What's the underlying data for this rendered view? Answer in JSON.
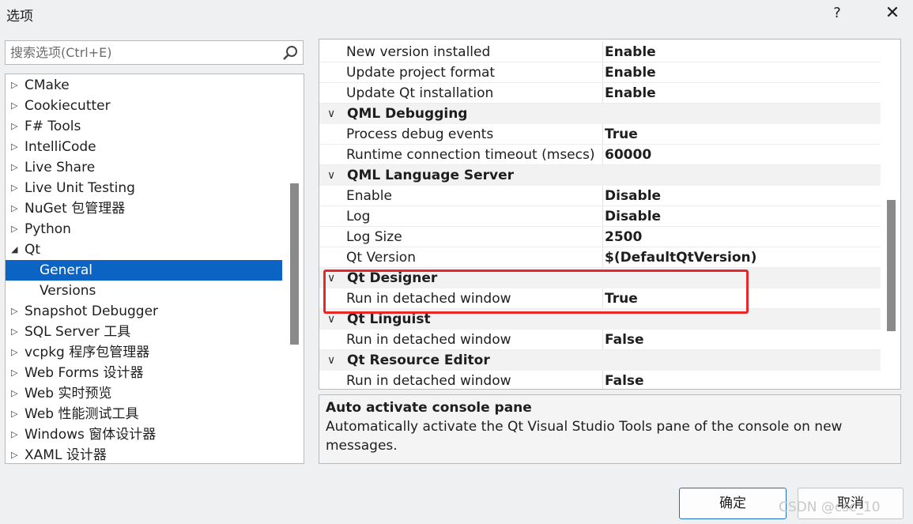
{
  "window": {
    "title": "选项",
    "help_glyph": "?",
    "close_glyph": "✕"
  },
  "search": {
    "placeholder": "搜索选项(Ctrl+E)",
    "icon": "search-icon"
  },
  "tree": {
    "collapsed_glyph": "▷",
    "expanded_glyph": "◢",
    "items": [
      {
        "label": "CMake",
        "state": "collapsed"
      },
      {
        "label": "Cookiecutter",
        "state": "collapsed"
      },
      {
        "label": "F# Tools",
        "state": "collapsed"
      },
      {
        "label": "IntelliCode",
        "state": "collapsed"
      },
      {
        "label": "Live Share",
        "state": "collapsed"
      },
      {
        "label": "Live Unit Testing",
        "state": "collapsed"
      },
      {
        "label": "NuGet 包管理器",
        "state": "collapsed"
      },
      {
        "label": "Python",
        "state": "collapsed"
      },
      {
        "label": "Qt",
        "state": "expanded"
      },
      {
        "label": "General",
        "state": "child",
        "selected": true
      },
      {
        "label": "Versions",
        "state": "child"
      },
      {
        "label": "Snapshot Debugger",
        "state": "collapsed"
      },
      {
        "label": "SQL Server 工具",
        "state": "collapsed"
      },
      {
        "label": "vcpkg 程序包管理器",
        "state": "collapsed"
      },
      {
        "label": "Web Forms 设计器",
        "state": "collapsed"
      },
      {
        "label": "Web 实时预览",
        "state": "collapsed"
      },
      {
        "label": "Web 性能测试工具",
        "state": "collapsed"
      },
      {
        "label": "Windows 窗体设计器",
        "state": "collapsed"
      },
      {
        "label": "XAML 设计器",
        "state": "collapsed"
      }
    ]
  },
  "grid": {
    "chevron_glyph": "∨",
    "rows": [
      {
        "type": "prop",
        "name": "New version installed",
        "value": "Enable"
      },
      {
        "type": "prop",
        "name": "Update project format",
        "value": "Enable"
      },
      {
        "type": "prop",
        "name": "Update Qt installation",
        "value": "Enable"
      },
      {
        "type": "cat",
        "name": "QML Debugging"
      },
      {
        "type": "prop",
        "name": "Process debug events",
        "value": "True"
      },
      {
        "type": "prop",
        "name": "Runtime connection timeout (msecs)",
        "value": "60000"
      },
      {
        "type": "cat",
        "name": "QML Language Server"
      },
      {
        "type": "prop",
        "name": "Enable",
        "value": "Disable"
      },
      {
        "type": "prop",
        "name": "Log",
        "value": "Disable"
      },
      {
        "type": "prop",
        "name": "Log Size",
        "value": "2500"
      },
      {
        "type": "prop",
        "name": "Qt Version",
        "value": "$(DefaultQtVersion)"
      },
      {
        "type": "cat",
        "name": "Qt Designer"
      },
      {
        "type": "prop",
        "name": "Run in detached window",
        "value": "True"
      },
      {
        "type": "cat",
        "name": "Qt Linguist"
      },
      {
        "type": "prop",
        "name": "Run in detached window",
        "value": "False"
      },
      {
        "type": "cat",
        "name": "Qt Resource Editor"
      },
      {
        "type": "prop",
        "name": "Run in detached window",
        "value": "False"
      }
    ]
  },
  "description": {
    "title": "Auto activate console pane",
    "text": "Automatically activate the Qt Visual Studio Tools pane of the console on new messages."
  },
  "buttons": {
    "ok": "确定",
    "cancel": "取消"
  },
  "watermark": "CSDN @csc_10",
  "colors": {
    "selection": "#0b63c4",
    "highlight_box": "#e8272a"
  }
}
